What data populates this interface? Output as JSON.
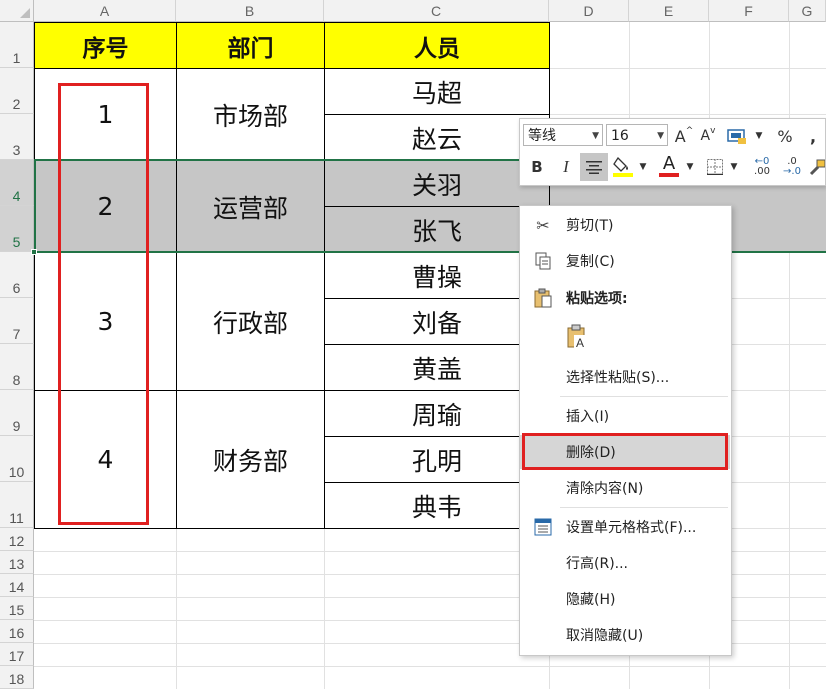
{
  "columns": [
    "A",
    "B",
    "C",
    "D",
    "E",
    "F",
    "G"
  ],
  "rows": [
    "1",
    "2",
    "3",
    "4",
    "5",
    "6",
    "7",
    "8",
    "9",
    "10",
    "11",
    "12",
    "13",
    "14",
    "15",
    "16",
    "17",
    "18"
  ],
  "table": {
    "headers": [
      "序号",
      "部门",
      "人员"
    ],
    "groups": [
      {
        "index": "1",
        "dept": "市场部",
        "people": [
          "马超",
          "赵云"
        ]
      },
      {
        "index": "2",
        "dept": "运营部",
        "people": [
          "关羽",
          "张飞"
        ]
      },
      {
        "index": "3",
        "dept": "行政部",
        "people": [
          "曹操",
          "刘备",
          "黄盖"
        ]
      },
      {
        "index": "4",
        "dept": "财务部",
        "people": [
          "周瑜",
          "孔明",
          "典韦"
        ]
      }
    ]
  },
  "mini_toolbar": {
    "font_name": "等线",
    "font_size": "16",
    "bold": "B",
    "italic": "I",
    "grow_font": "A",
    "shrink_font": "A",
    "percent": "%",
    "comma": ",",
    "increase_decimal": ".00",
    "decrease_decimal": ".0",
    "font_color_letter": "A"
  },
  "context_menu": {
    "cut": "剪切(T)",
    "copy": "复制(C)",
    "paste_options": "粘贴选项:",
    "paste_special": "选择性粘贴(S)...",
    "insert": "插入(I)",
    "delete": "删除(D)",
    "clear": "清除内容(N)",
    "format_cells": "设置单元格格式(F)...",
    "row_height": "行高(R)...",
    "hide": "隐藏(H)",
    "unhide": "取消隐藏(U)"
  },
  "colors": {
    "header_fill": "#ffff00",
    "selection_fill": "#c6c6c6",
    "highlight_red": "#e02020",
    "selection_border": "#217346"
  }
}
